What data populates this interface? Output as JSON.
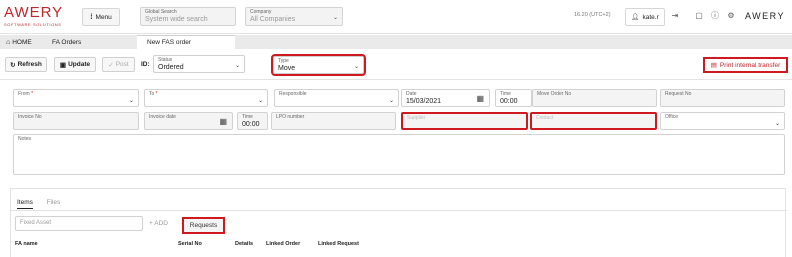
{
  "brand": {
    "word": "AWERY",
    "tagline": "SOFTWARE SOLUTIONS",
    "right_word": "AWERY"
  },
  "header": {
    "menu_label": "Menu",
    "global_search": {
      "label": "Global Search",
      "placeholder": "System wide search"
    },
    "company": {
      "label": "Company",
      "value": "All Companies"
    },
    "version": "16.20 (UTC+2)",
    "user": "kate.r"
  },
  "nav": {
    "home": "HOME",
    "fa_orders": "FA Orders",
    "new_order": "New FAS order"
  },
  "toolbar": {
    "refresh": "Refresh",
    "update": "Update",
    "post": "Post",
    "id_label": "ID:",
    "status": {
      "label": "Status",
      "value": "Ordered"
    },
    "type": {
      "label": "Type",
      "value": "Move"
    },
    "print": "Print internal transfer"
  },
  "form": {
    "from": {
      "label": "From",
      "req": "*"
    },
    "to": {
      "label": "To",
      "req": "*"
    },
    "responsible": {
      "label": "Responsible"
    },
    "date": {
      "label": "Date",
      "value": "15/03/2021"
    },
    "time1": {
      "label": "Time",
      "value": "00:00"
    },
    "move_order_no": {
      "label": "Move Order No"
    },
    "request_no": {
      "label": "Request No"
    },
    "invoice_no": {
      "label": "Invoice No"
    },
    "invoice_date": {
      "label": "Invoice date"
    },
    "time2": {
      "label": "Time",
      "value": "00:00"
    },
    "lpo_number": {
      "label": "LPO number"
    },
    "supplier": {
      "label": "Supplier"
    },
    "contact": {
      "label": "Contact"
    },
    "office": {
      "label": "Office"
    },
    "notes": {
      "label": "Notes"
    }
  },
  "lower": {
    "tab_items": "Items",
    "tab_files": "Files",
    "asset_placeholder": "Fixed Asset",
    "add": "+ ADD",
    "requests": "Requests",
    "columns": [
      "FA name",
      "Serial No",
      "Details",
      "Linked Order",
      "Linked Request"
    ]
  }
}
